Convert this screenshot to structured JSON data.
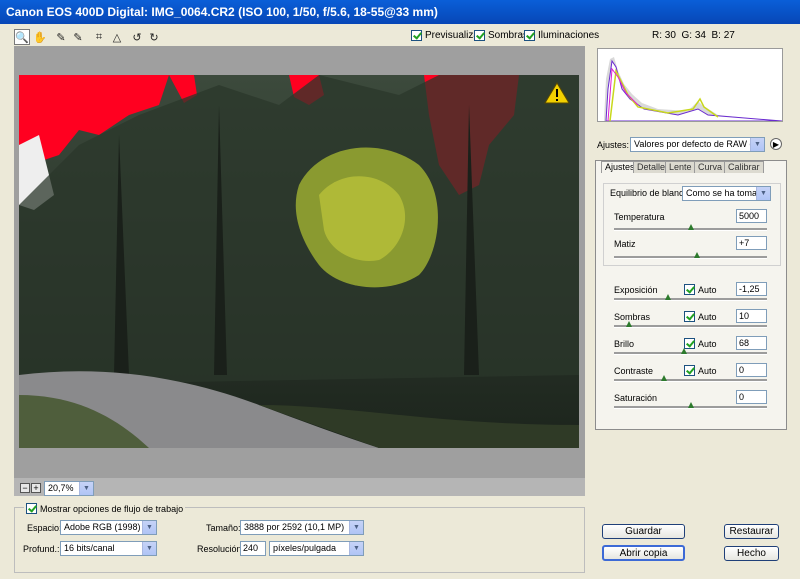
{
  "window": {
    "title": "Canon EOS 400D Digital:  IMG_0064.CR2  (ISO 100, 1/50, f/5.6, 18-55@33 mm)"
  },
  "tools": [
    {
      "name": "zoom-tool-icon",
      "glyph": "🔍"
    },
    {
      "name": "hand-tool-icon",
      "glyph": "✋"
    },
    {
      "name": "white-balance-tool-icon",
      "glyph": "✎"
    },
    {
      "name": "color-sampler-tool-icon",
      "glyph": "✎"
    },
    {
      "name": "crop-tool-icon",
      "glyph": "⌗"
    },
    {
      "name": "straighten-tool-icon",
      "glyph": "△"
    },
    {
      "name": "rotate-left-icon",
      "glyph": "↺"
    },
    {
      "name": "rotate-right-icon",
      "glyph": "↻"
    }
  ],
  "preview_options": {
    "preview": {
      "label": "Previsualizar",
      "checked": true
    },
    "shadows": {
      "label": "Sombras",
      "checked": true
    },
    "highlights": {
      "label": "Iluminaciones",
      "checked": true
    }
  },
  "rgb_readout": {
    "r_label": "R:",
    "r": "30",
    "g_label": "G:",
    "g": "34",
    "b_label": "B:",
    "b": "27"
  },
  "zoom": {
    "value": "20,7%",
    "minus": "−",
    "plus": "+"
  },
  "settings": {
    "label": "Ajustes:",
    "value": "Valores por defecto de RAW de cám"
  },
  "tabs": [
    "Ajustes",
    "Detalle",
    "Lente",
    "Curva",
    "Calibrar"
  ],
  "white_balance": {
    "label": "Equilibrio de blancos:",
    "value": "Como se ha tomado",
    "temperature": {
      "label": "Temperatura",
      "value": "5000",
      "level": 0.5
    },
    "tint": {
      "label": "Matiz",
      "value": "+7",
      "level": 0.54
    }
  },
  "adjustments": [
    {
      "key": "exposure",
      "label": "Exposición",
      "auto": true,
      "auto_label": "Auto",
      "value": "-1,25",
      "level": 0.35
    },
    {
      "key": "shadows",
      "label": "Sombras",
      "auto": true,
      "auto_label": "Auto",
      "value": "10",
      "level": 0.1
    },
    {
      "key": "brightness",
      "label": "Brillo",
      "auto": true,
      "auto_label": "Auto",
      "value": "68",
      "level": 0.46
    },
    {
      "key": "contrast",
      "label": "Contraste",
      "auto": true,
      "auto_label": "Auto",
      "value": "0",
      "level": 0.33
    },
    {
      "key": "saturation",
      "label": "Saturación",
      "auto": false,
      "auto_label": "",
      "value": "0",
      "level": 0.5
    }
  ],
  "workflow": {
    "toggle_label": "Mostrar opciones de flujo de trabajo",
    "space_label": "Espacio:",
    "space_value": "Adobe RGB (1998)",
    "depth_label": "Profund.:",
    "depth_value": "16 bits/canal",
    "size_label": "Tamaño:",
    "size_value": "3888 por 2592  (10,1 MP)",
    "resolution_label": "Resolución:",
    "resolution_value": "240",
    "resolution_unit": "píxeles/pulgada"
  },
  "buttons": {
    "save": "Guardar",
    "reset": "Restaurar",
    "open_copy": "Abrir copia",
    "done": "Hecho"
  },
  "colors": {
    "clip_highlight": "#ff0020",
    "title_bar": "#0a5fd8",
    "warning": "#f3d000"
  }
}
